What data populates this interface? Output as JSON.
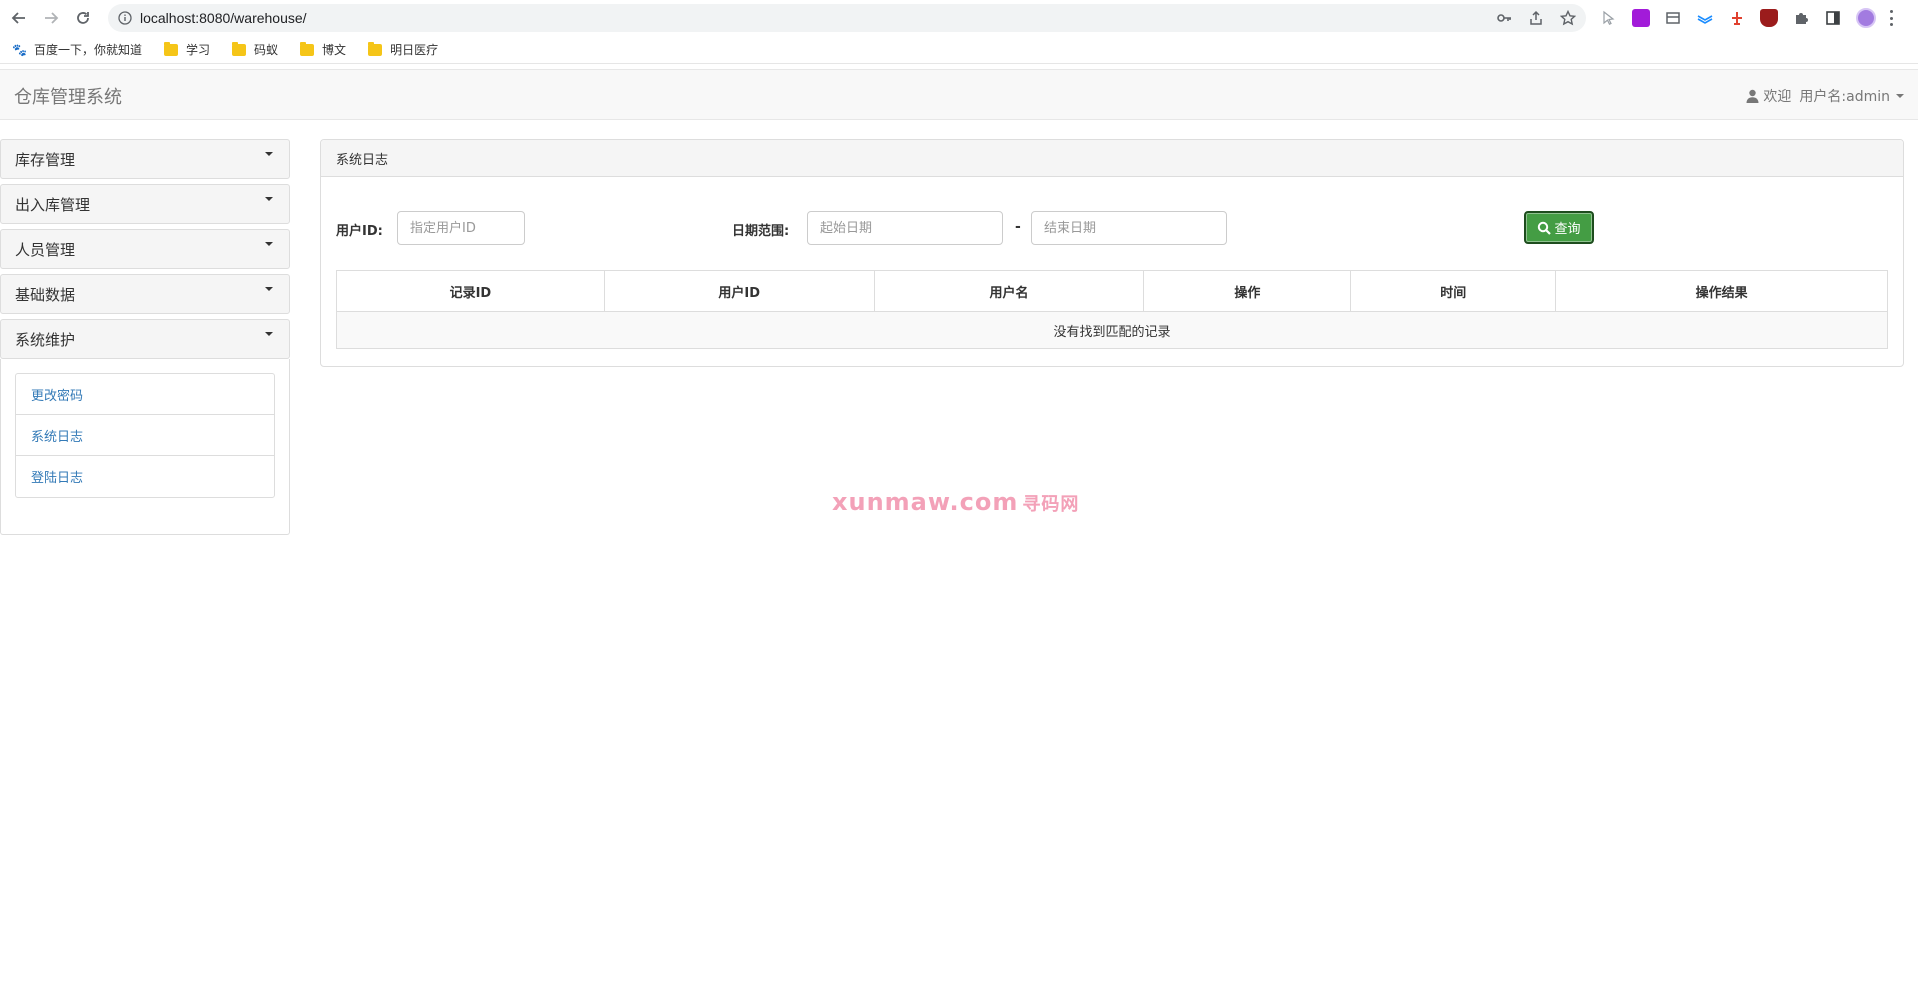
{
  "browser": {
    "url": "localhost:8080/warehouse/",
    "bookmarks": [
      {
        "label": "百度一下，你就知道",
        "icon": "baidu-paw-icon"
      },
      {
        "label": "学习",
        "icon": "folder-icon"
      },
      {
        "label": "码蚁",
        "icon": "folder-icon"
      },
      {
        "label": "博文",
        "icon": "folder-icon"
      },
      {
        "label": "明日医疗",
        "icon": "folder-icon"
      }
    ]
  },
  "navbar": {
    "brand": "仓库管理系统",
    "welcome": "欢迎",
    "username": "用户名:admin"
  },
  "sidebar": {
    "menus": [
      {
        "label": "库存管理"
      },
      {
        "label": "出入库管理"
      },
      {
        "label": "人员管理"
      },
      {
        "label": "基础数据"
      },
      {
        "label": "系统维护"
      }
    ],
    "submenu": [
      {
        "label": "更改密码"
      },
      {
        "label": "系统日志"
      },
      {
        "label": "登陆日志"
      }
    ]
  },
  "main": {
    "heading": "系统日志",
    "user_id_label": "用户ID:",
    "user_id_placeholder": "指定用户ID",
    "date_range_label": "日期范围:",
    "start_date_placeholder": "起始日期",
    "date_separator": "-",
    "end_date_placeholder": "结束日期",
    "search_button": "查询",
    "table": {
      "columns": [
        "记录ID",
        "用户ID",
        "用户名",
        "操作",
        "时间",
        "操作结果"
      ],
      "empty_message": "没有找到匹配的记录"
    }
  },
  "watermark": {
    "text": "xunmaw.com",
    "text_cn": "寻码网"
  },
  "colors": {
    "link": "#337ab7",
    "button_green": "#449d44",
    "watermark": "#f3a1b8"
  }
}
